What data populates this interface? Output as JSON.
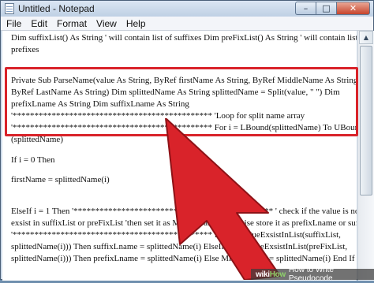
{
  "window": {
    "title": "Untitled - Notepad",
    "controls": {
      "minimize": "–",
      "maximize": "□",
      "close": "✕"
    }
  },
  "menubar": [
    "File",
    "Edit",
    "Format",
    "View",
    "Help"
  ],
  "document": {
    "lines": [
      "Dim suffixList() As String ' will contain list of suffixes Dim preFixList() As String ' will contain list of",
      "prefixes",
      "Private Sub ParseName(value As String, ByRef firstName As String, ByRef MiddleName As String,",
      "ByRef LastName As String) Dim splittedName As String splittedName = Split(value, \" \") Dim",
      "prefixLname As String Dim suffixLname As String",
      "'********************************************** 'Loop for split name array",
      "'********************************************** For i = LBound(splittedName) To UBound",
      "(splittedName)",
      "If i = 0 Then",
      "firstName = splittedName(i)",
      "ElseIf i = 1 Then '********************************************** ' check if the value is not",
      "exsist in suffixList or preFixList 'then set it as MiddleName otherwise store it as prefixLname or suffixLname",
      "'********************************************** If Not (ValueExsistInList(suffixList,",
      "splittedName(i))) Then suffixLname = splittedName(i) ElseIf Not (ValueExsistInList(preFixList,",
      "splittedName(i))) Then prefixLname = splittedName(i) Else MiddleName = splittedName(i) End If"
    ]
  },
  "colors": {
    "highlight": "#d9232a",
    "arrow": "#d9232a"
  },
  "watermark": {
    "logo_prefix": "wiki",
    "logo_suffix": "How",
    "text": "How to Write Pseudocode"
  }
}
